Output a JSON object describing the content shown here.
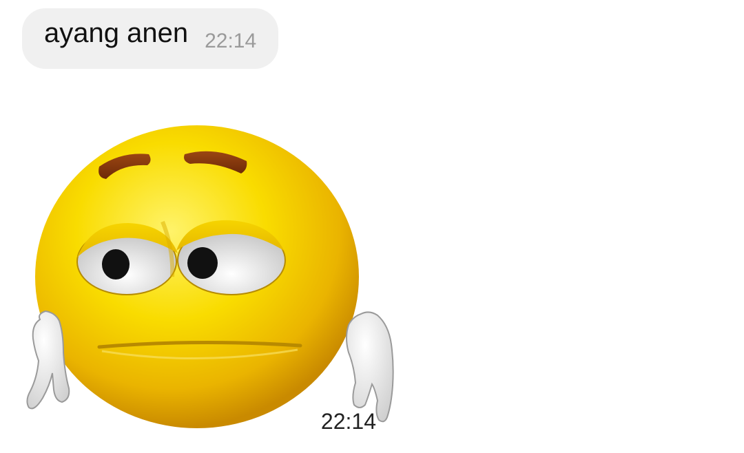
{
  "messages": [
    {
      "type": "text",
      "text": "ayang anen",
      "time": "22:14"
    },
    {
      "type": "sticker",
      "sticker_icon": "sad-emoji-shrug-sticker",
      "time": "22:14"
    }
  ],
  "colors": {
    "bubble_bg": "#f0f0f0",
    "emoji_yellow": "#f7d000",
    "eyebrow_brown": "#8a3a12",
    "time_gray": "#9a9a9a"
  }
}
